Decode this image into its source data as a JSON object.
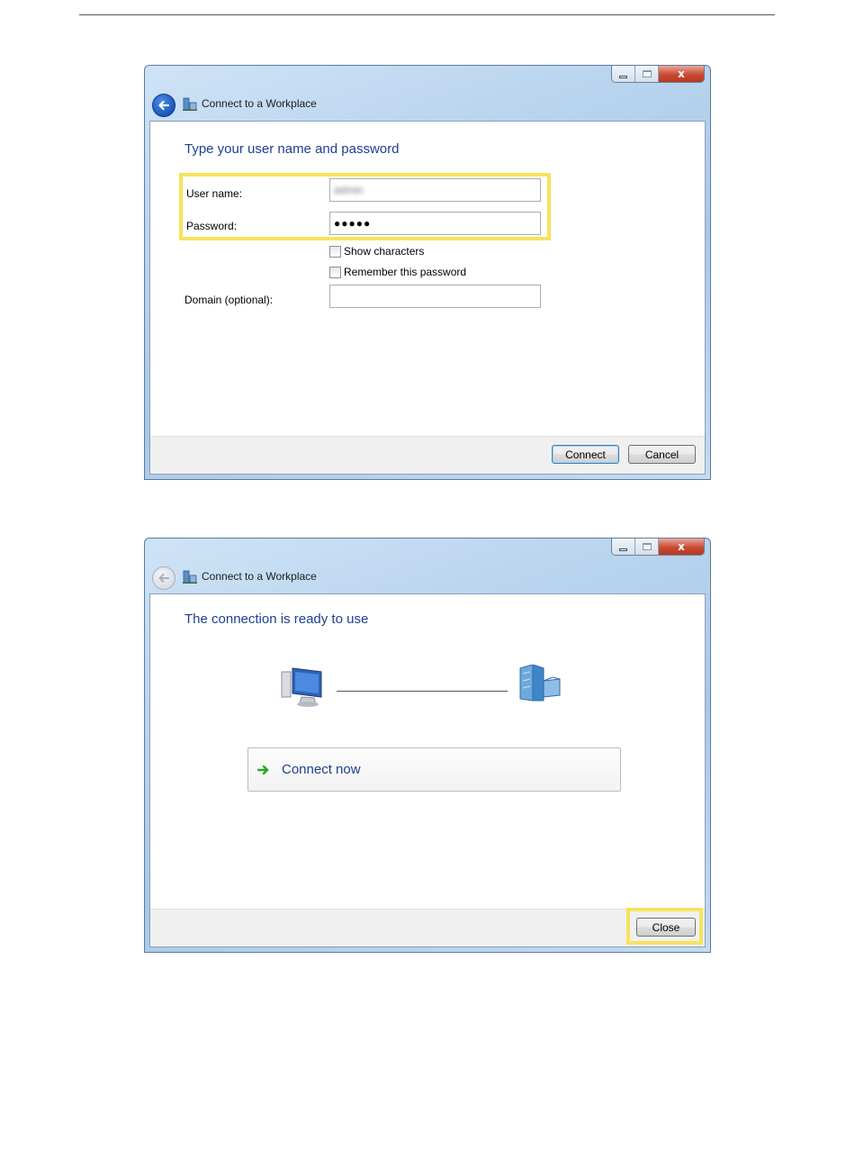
{
  "window1": {
    "title": "Connect to a Workplace",
    "heading": "Type your user name and password",
    "username_label": "User name:",
    "username_value": "admin",
    "password_label": "Password:",
    "password_value": "●●●●●",
    "show_characters_label": "Show characters",
    "remember_password_label": "Remember this password",
    "domain_label": "Domain (optional):",
    "domain_value": "",
    "connect_button": "Connect",
    "cancel_button": "Cancel",
    "close_glyph": "x"
  },
  "window2": {
    "title": "Connect to a Workplace",
    "heading": "The connection is ready to use",
    "connect_now_label": "Connect now",
    "close_button": "Close",
    "close_glyph": "x"
  },
  "icons": {
    "back": "back-arrow-icon",
    "workplace": "workplace-icon",
    "computer": "computer-icon",
    "building": "office-building-icon",
    "connect_arrow": "green-arrow-icon"
  },
  "colors": {
    "heading_blue": "#1e3f8e",
    "highlight_yellow": "#f7e35c",
    "close_red": "#c84a32"
  }
}
